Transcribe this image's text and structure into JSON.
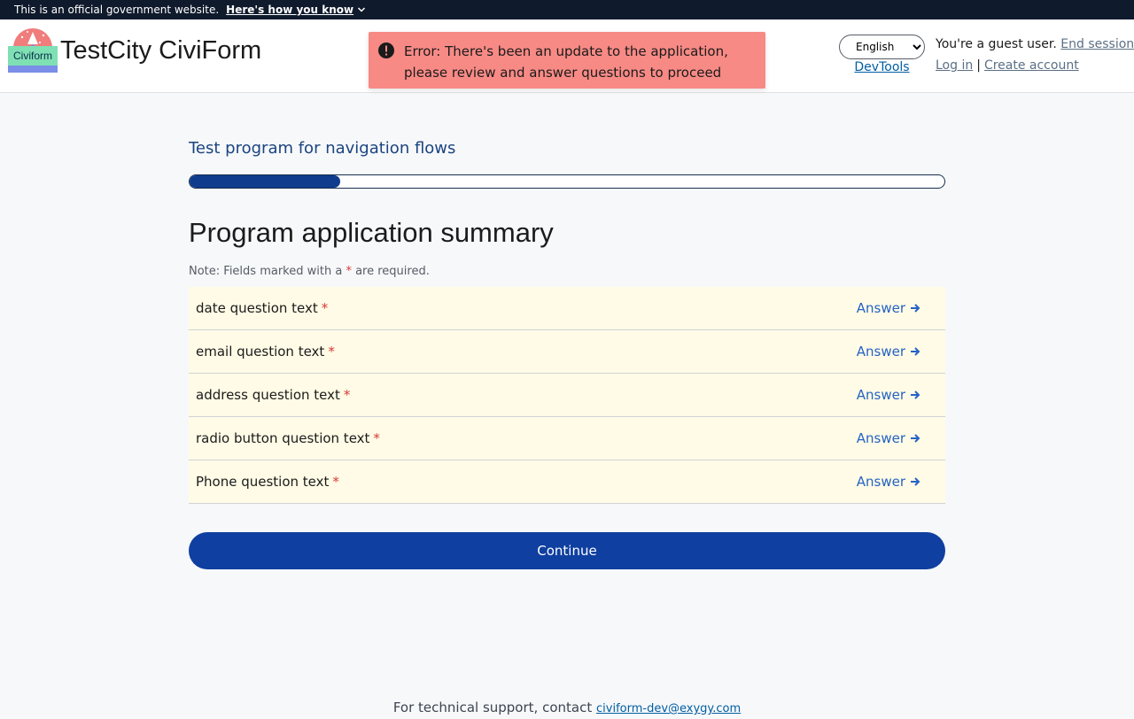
{
  "gov_banner": {
    "text": "This is an official government website.",
    "how_link": "Here's how you know"
  },
  "header": {
    "logo_word": "Civiform",
    "app_title": "TestCity CiviForm",
    "language": {
      "selected": "English",
      "options": [
        "English"
      ]
    },
    "devtools_label": "DevTools",
    "guest_text": "You're a guest user.",
    "end_session_label": "End session",
    "login_label": "Log in",
    "separator": "|",
    "create_account_label": "Create account"
  },
  "alert": {
    "message": "Error: There's been an update to the application, please review and answer questions to proceed",
    "color": "#f88a85"
  },
  "main": {
    "program_name": "Test program for navigation flows",
    "progress_percent": 20,
    "page_title": "Program application summary",
    "note_prefix": "Note: Fields marked with a",
    "required_marker": "*",
    "note_suffix": "are required.",
    "questions": [
      {
        "text": "date question text",
        "action": "Answer"
      },
      {
        "text": "email question text",
        "action": "Answer"
      },
      {
        "text": "address question text",
        "action": "Answer"
      },
      {
        "text": "radio button question text",
        "action": "Answer"
      },
      {
        "text": "Phone question text",
        "action": "Answer"
      }
    ],
    "continue_label": "Continue"
  },
  "footer": {
    "text": "For technical support, contact",
    "email": "civiform-dev@exygy.com"
  },
  "colors": {
    "primary": "#0f3fa0",
    "link": "#2563c4",
    "required": "#d83933",
    "row_bg": "#fffbe6"
  }
}
